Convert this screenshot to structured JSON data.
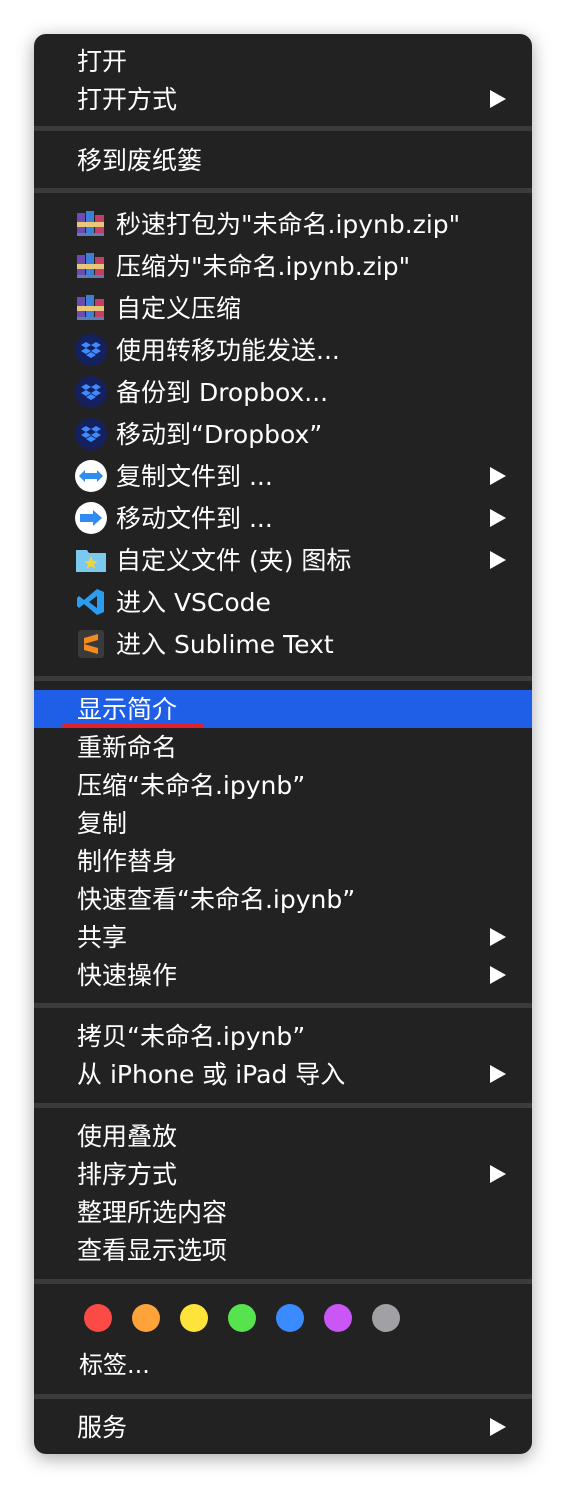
{
  "menu": {
    "open": "打开",
    "open_with": "打开方式",
    "move_to_trash": "移到废纸篓",
    "services_items": [
      {
        "label": "秒速打包为\"未命名.ipynb.zip\"",
        "icon": "winrar-books-icon"
      },
      {
        "label": "压缩为\"未命名.ipynb.zip\"",
        "icon": "winrar-books-icon"
      },
      {
        "label": "自定义压缩",
        "icon": "winrar-books-icon"
      },
      {
        "label": "使用转移功能发送...",
        "icon": "dropbox-icon"
      },
      {
        "label": "备份到 Dropbox...",
        "icon": "dropbox-icon"
      },
      {
        "label": "移动到“Dropbox”",
        "icon": "dropbox-icon"
      },
      {
        "label": "复制文件到 ...",
        "icon": "copy-file-arrow-icon"
      },
      {
        "label": "移动文件到 ...",
        "icon": "move-file-arrow-icon"
      },
      {
        "label": "自定义文件 (夹) 图标",
        "icon": "folder-star-icon"
      },
      {
        "label": "进入 VSCode",
        "icon": "vscode-icon"
      },
      {
        "label": "进入 Sublime Text",
        "icon": "sublime-text-icon"
      }
    ],
    "get_info": "显示简介",
    "rename": "重新命名",
    "compress": "压缩“未命名.ipynb”",
    "duplicate": "复制",
    "make_alias": "制作替身",
    "quick_look": "快速查看“未命名.ipynb”",
    "share": "共享",
    "quick_actions": "快速操作",
    "copy_item": "拷贝“未命名.ipynb”",
    "import_from_iphone": "从 iPhone 或 iPad 导入",
    "use_stacks": "使用叠放",
    "sort_by": "排序方式",
    "clean_up": "整理所选内容",
    "show_view_options": "查看显示选项",
    "tags_label": "标签...",
    "services": "服务"
  },
  "tag_colors": [
    "#fc4a45",
    "#fea33a",
    "#fee33b",
    "#57e34d",
    "#3a8bff",
    "#c956f5",
    "#a0a0a5"
  ],
  "colors": {
    "menu_bg": "#222222",
    "highlight": "#1f5ee6",
    "separator": "#3b3b3b",
    "underline_annotation": "#e0202b"
  }
}
